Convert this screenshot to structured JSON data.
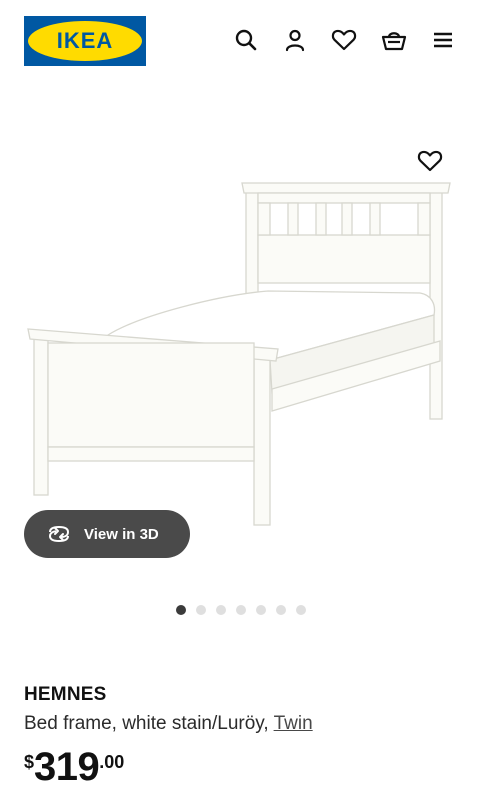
{
  "header": {
    "logo_text": "IKEA",
    "brand_blue": "#0058a3",
    "brand_yellow": "#ffdb00",
    "icons": [
      "search-icon",
      "account-icon",
      "heart-icon",
      "shopping-bag-icon",
      "menu-icon"
    ]
  },
  "gallery": {
    "view_3d_label": "View in 3D",
    "image_count": 7,
    "active_image": 1
  },
  "product": {
    "name": "HEMNES",
    "description": "Bed frame, white stain/Luröy, ",
    "size_link": "Twin",
    "price": {
      "currency": "$",
      "integer": "319",
      "decimal": ".00"
    }
  }
}
